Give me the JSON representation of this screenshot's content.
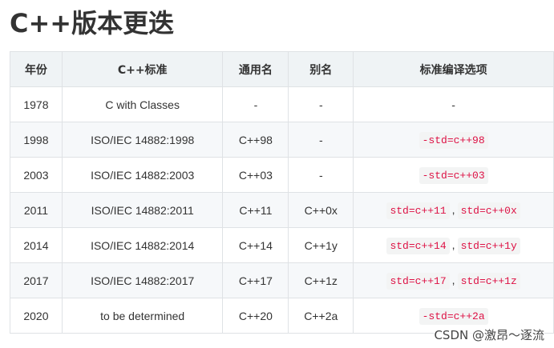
{
  "title": "C++版本更迭",
  "table": {
    "headers": [
      "年份",
      "C++标准",
      "通用名",
      "别名",
      "标准编译选项"
    ],
    "rows": [
      {
        "year": "1978",
        "standard": "C with Classes",
        "common": "-",
        "alias": "-",
        "options": [
          "-"
        ],
        "code": false
      },
      {
        "year": "1998",
        "standard": "ISO/IEC 14882:1998",
        "common": "C++98",
        "alias": "-",
        "options": [
          "-std=c++98"
        ],
        "code": true
      },
      {
        "year": "2003",
        "standard": "ISO/IEC 14882:2003",
        "common": "C++03",
        "alias": "-",
        "options": [
          "-std=c++03"
        ],
        "code": true
      },
      {
        "year": "2011",
        "standard": "ISO/IEC 14882:2011",
        "common": "C++11",
        "alias": "C++0x",
        "options": [
          "std=c++11",
          "std=c++0x"
        ],
        "code": true
      },
      {
        "year": "2014",
        "standard": "ISO/IEC 14882:2014",
        "common": "C++14",
        "alias": "C++1y",
        "options": [
          "std=c++14",
          "std=c++1y"
        ],
        "code": true
      },
      {
        "year": "2017",
        "standard": "ISO/IEC 14882:2017",
        "common": "C++17",
        "alias": "C++1z",
        "options": [
          "std=c++17",
          "std=c++1z"
        ],
        "code": true
      },
      {
        "year": "2020",
        "standard": "to be determined",
        "common": "C++20",
        "alias": "C++2a",
        "options": [
          "-std=c++2a"
        ],
        "code": true
      }
    ]
  },
  "option_separator": ",",
  "watermark": "CSDN @激昂～逐流",
  "colors": {
    "header_bg": "#eff3f5",
    "stripe_bg": "#f6f8fa",
    "code_text": "#dd1144",
    "code_bg": "#f3f4f4",
    "border": "#dfe2e5"
  }
}
